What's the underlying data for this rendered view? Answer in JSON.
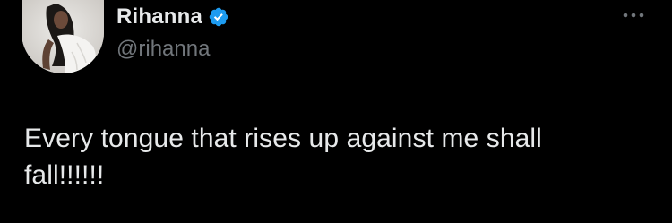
{
  "author": {
    "display_name": "Rihanna",
    "handle": "@rihanna",
    "verified": true,
    "verified_icon": "verified-badge-icon",
    "avatar_icon": "profile-avatar"
  },
  "tweet": {
    "text": "Every tongue that rises up against me shall\nfall!!!!!!"
  },
  "actions": {
    "more_icon": "more-options-icon"
  },
  "colors": {
    "background": "#000000",
    "primary_text": "#e7e9ea",
    "secondary_text": "#71767b",
    "verified_blue": "#1d9bf0"
  }
}
